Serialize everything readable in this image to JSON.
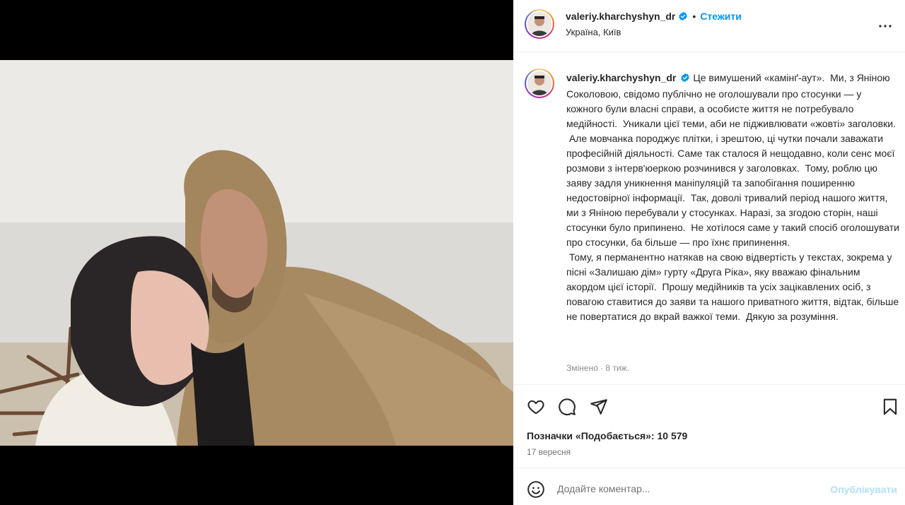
{
  "colors": {
    "accent": "#0095f6",
    "text": "#262626",
    "muted": "#737373",
    "publish_disabled": "#b2dffc",
    "verified": "#0095f6"
  },
  "post": {
    "username": "valeriy.kharchyshyn_dr",
    "follow_label": "Стежити",
    "location": "Україна, Київ",
    "more_icon": "more-horizontal-icon",
    "caption": "Це вимушений «камінґ-аут».  Ми, з Яніною Соколовою, свідомо публічно не оголошували про стосунки — у кожного були власні справи, а особисте життя не потребувало медійності.  Уникали цієї теми, аби не підживлювати «жовті» заголовки.\n Але мовчанка породжує плітки, і зрештою, ці чутки почали заважати професійній діяльності. Саме так сталося й нещодавно, коли сенс моєї розмови з інтерв'юеркою розчинився у заголовках.  Тому, роблю цю заяву задля уникнення маніпуляцій та запобігання поширенню недостовірної інформації.  Так, доволі тривалий період нашого життя, ми з Яніною перебували у стосунках. Наразі, за згодою сторін, наші стосунки було припинено.  Не хотілося саме у такий спосіб оголошувати про стосунки, ба більше — про їхнє припинення.\n Тому, я перманентно натякав на свою відвертість у текстах, зокрема у пісні «Залишаю дім» гурту «Друга Ріка», яку вважаю фінальним акордом цієї історії.  Прошу медійників та усіх зацікавлених осіб, з повагою ставитися до заяви та нашого приватного життя, відтак, більше не повертатися до вкрай важкої теми.  Дякую за розуміння.",
    "edited": "Змінено · 8 тиж.",
    "likes_text": "Позначки «Подобається»: 10 579",
    "date": "17 вересня",
    "comment_placeholder": "Додайте коментар...",
    "publish_label": "Опублікувати"
  },
  "icons": {
    "like": "heart-icon",
    "comment": "comment-icon",
    "share": "share-icon",
    "save": "bookmark-icon",
    "emoji": "emoji-icon",
    "verified": "verified-badge-icon"
  }
}
